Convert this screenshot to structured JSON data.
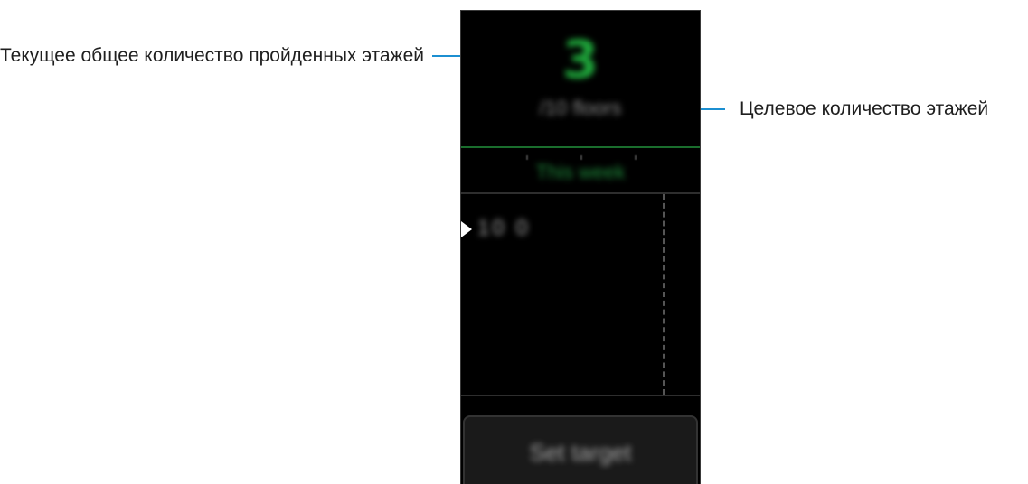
{
  "callouts": {
    "current_total": "Текущее общее количество пройденных этажей",
    "target_floors": "Целевое количество этажей"
  },
  "screen": {
    "current_floors": "3",
    "target_text": "/10 floors",
    "period_label": "This week",
    "graph_value": "10 0",
    "set_target_button": "Set target"
  },
  "colors": {
    "accent_green": "#1ea53a",
    "leader_line_blue": "#1c8fd1",
    "screen_background": "#000000"
  }
}
